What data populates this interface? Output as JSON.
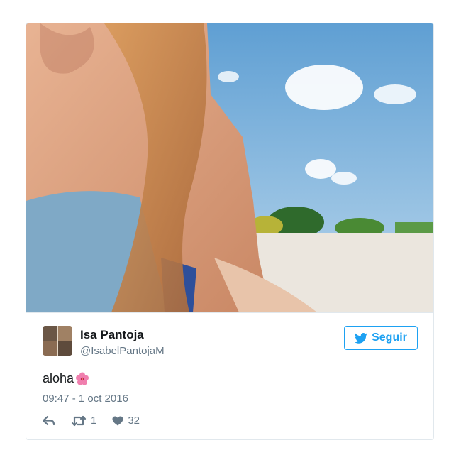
{
  "tweet": {
    "display_name": "Isa Pantoja",
    "handle": "@IsabelPantojaM",
    "follow_label": "Seguir",
    "text": "aloha",
    "text_emoji": "hibiscus-icon",
    "timestamp": "09:47 - 1 oct 2016",
    "retweets": "1",
    "likes": "32",
    "icons": {
      "follow": "bird-icon",
      "reply": "reply-icon",
      "retweet": "retweet-icon",
      "like": "heart-icon"
    },
    "colors": {
      "accent": "#1da1f2",
      "muted": "#657786",
      "border": "#e1e8ed"
    }
  }
}
